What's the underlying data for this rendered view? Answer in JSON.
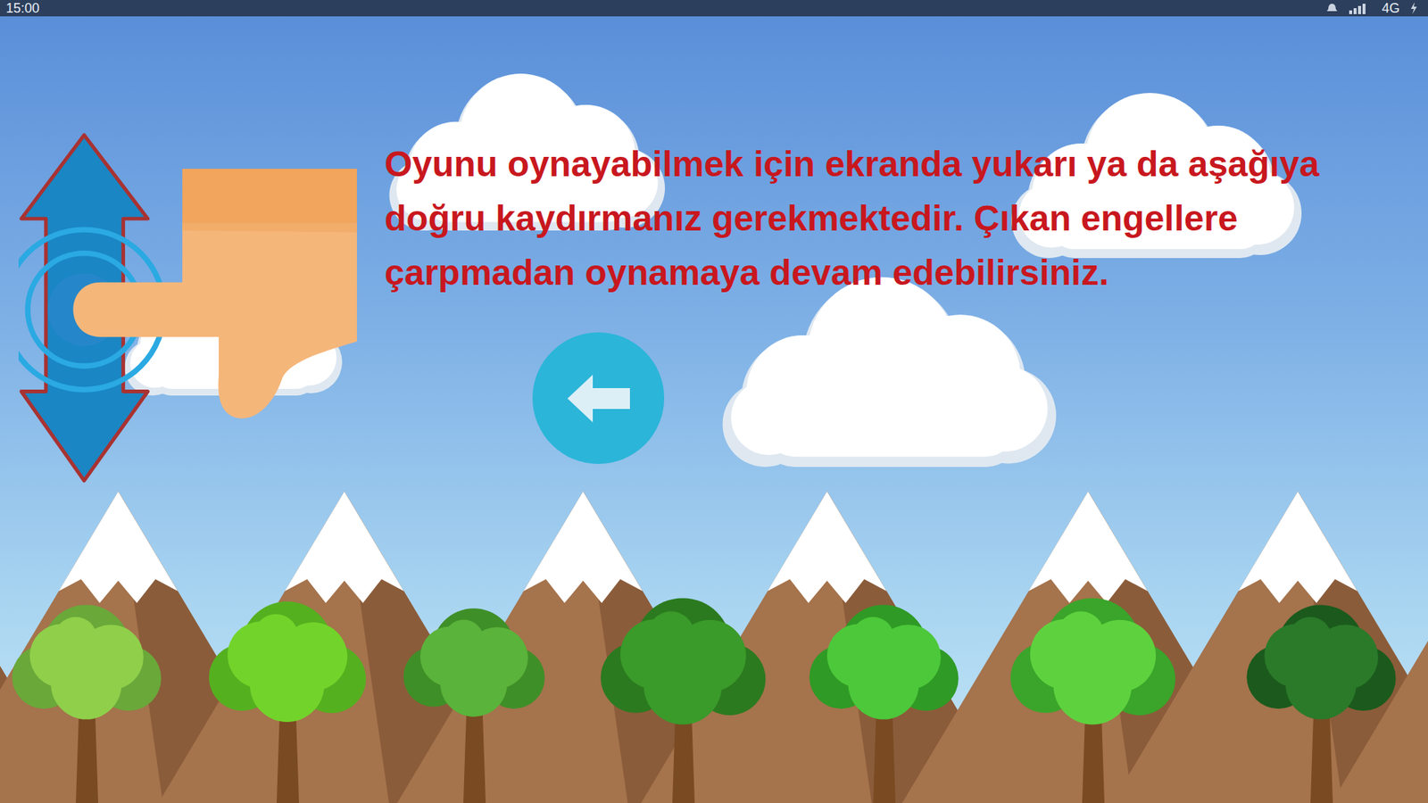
{
  "status_bar": {
    "time": "15:00",
    "network": "4G"
  },
  "instructions": {
    "text": "Oyunu oynayabilmek için ekranda yukarı ya da aşağıya doğru kaydırmanız gerekmektedir. Çıkan engellere çarpmadan oynamaya devam edebilirsiniz."
  }
}
